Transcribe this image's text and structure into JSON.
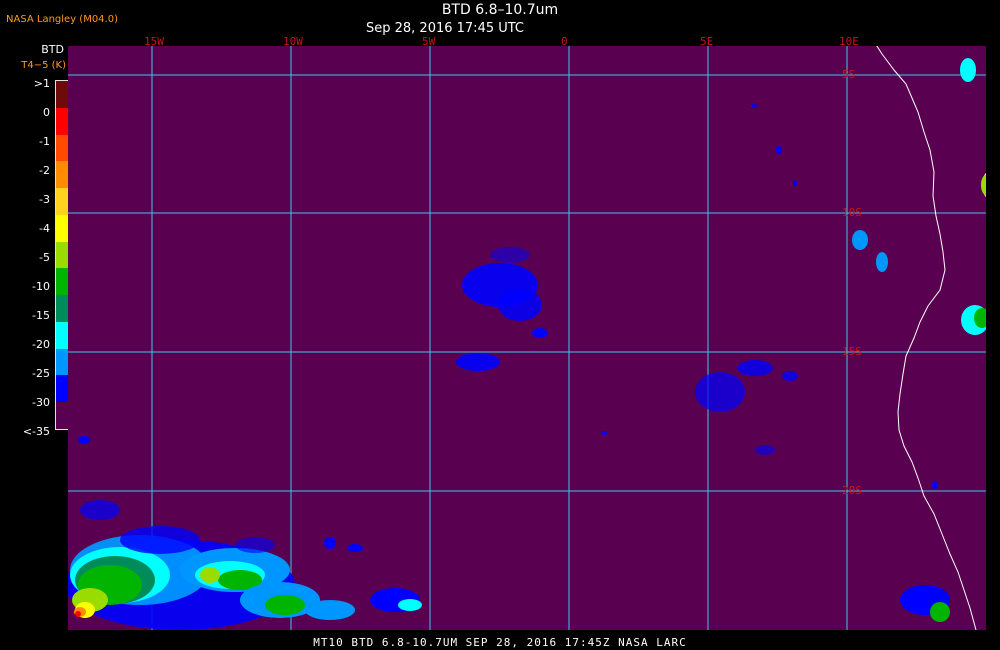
{
  "header": {
    "agency": "NASA Langley (M04.0)",
    "title": "BTD 6.8–10.7um",
    "subtitle": "Sep 28, 2016 17:45 UTC"
  },
  "legend": {
    "title": "BTD",
    "subtitle": "T4−5 (K)",
    "entries": [
      {
        "label": ">1",
        "color": "#6e0a0a"
      },
      {
        "label": "0",
        "color": "#ff0000"
      },
      {
        "label": "-1",
        "color": "#ff4a00"
      },
      {
        "label": "-2",
        "color": "#ff8c00"
      },
      {
        "label": "-3",
        "color": "#ffd21e"
      },
      {
        "label": "-4",
        "color": "#ffff00"
      },
      {
        "label": "-5",
        "color": "#9bdc00"
      },
      {
        "label": "-10",
        "color": "#00b400"
      },
      {
        "label": "-15",
        "color": "#008c5a"
      },
      {
        "label": "-20",
        "color": "#00ffff"
      },
      {
        "label": "-25",
        "color": "#0096ff"
      },
      {
        "label": "-30",
        "color": "#0000ff"
      },
      {
        "label": "<-35",
        "color": "#5a0050"
      }
    ]
  },
  "map": {
    "background_color": "#5a0050",
    "grid_color": "#3cc8f0",
    "coast_color": "#ffffff",
    "longitude_labels": [
      "15W",
      "10W",
      "5W",
      "0",
      "5E",
      "10E"
    ],
    "latitude_labels": [
      "5S",
      "10S",
      "15S",
      "20S"
    ]
  },
  "footer": {
    "caption": "MT10  BTD 6.8-10.7UM   SEP 28, 2016 17:45Z   NASA LARC"
  }
}
